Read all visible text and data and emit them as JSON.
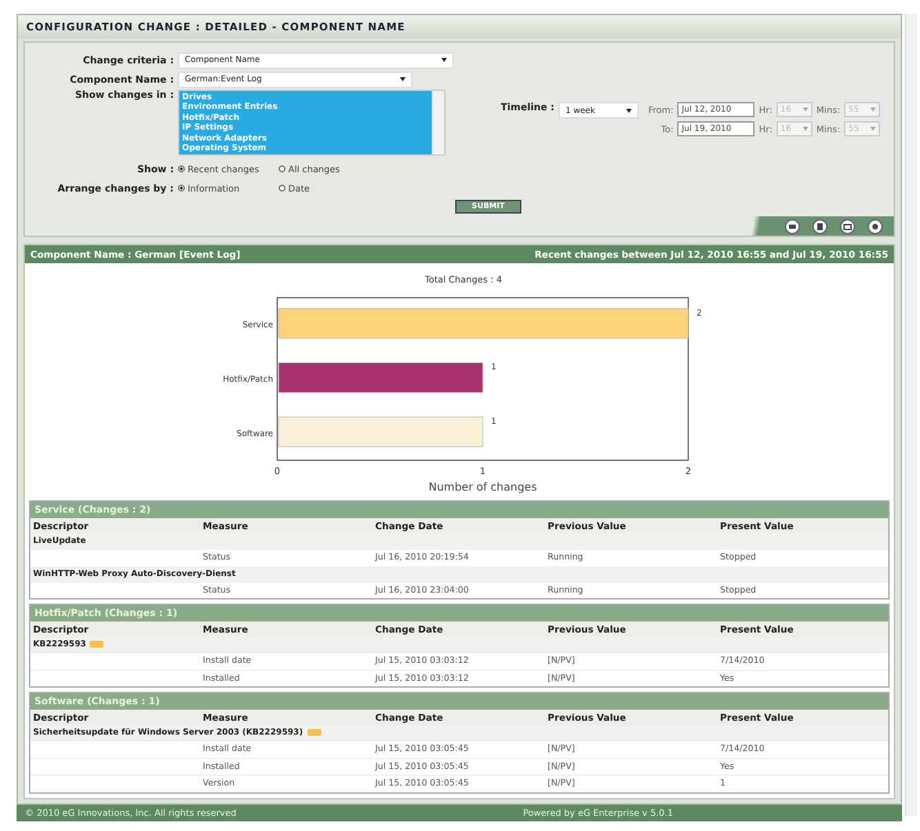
{
  "page_title": "CONFIGURATION CHANGE : DETAILED - COMPONENT NAME",
  "form": {
    "change_criteria": {
      "label": "Change criteria :",
      "value": "Component Name"
    },
    "component_name": {
      "label": "Component Name :",
      "value": "German:Event Log"
    },
    "show_changes_in": {
      "label": "Show changes in :",
      "items": [
        {
          "label": "Drives",
          "selected": true
        },
        {
          "label": "Environment Entries",
          "selected": true
        },
        {
          "label": "Hotfix/Patch",
          "selected": true
        },
        {
          "label": "IP Settings",
          "selected": true
        },
        {
          "label": "Network Adapters",
          "selected": true
        },
        {
          "label": "Operating System",
          "selected": true
        }
      ]
    },
    "show": {
      "label": "Show :",
      "options": [
        {
          "label": "Recent changes",
          "selected": true
        },
        {
          "label": "All changes",
          "selected": false
        }
      ]
    },
    "arrange_by": {
      "label": "Arrange changes by :",
      "options": [
        {
          "label": "Information",
          "selected": true
        },
        {
          "label": "Date",
          "selected": false
        }
      ]
    },
    "submit": "SUBMIT",
    "timeline": {
      "label": "Timeline :",
      "value": "1 week",
      "ranges": [
        {
          "label": "From:",
          "date": "Jul 12, 2010",
          "hr_label": "Hr:",
          "hr": "16",
          "mins_label": "Mins:",
          "mins": "55",
          "disabled": true
        },
        {
          "label": "To:",
          "date": "Jul 19, 2010",
          "hr_label": "Hr:",
          "hr": "16",
          "mins_label": "Mins:",
          "mins": "55",
          "disabled": true
        }
      ]
    }
  },
  "result_header": {
    "left": "Component Name : German [Event Log]",
    "right": "Recent changes between Jul 12, 2010 16:55 and Jul 19, 2010 16:55"
  },
  "chart_data": {
    "type": "bar",
    "orientation": "horizontal",
    "title": "Total Changes : 4",
    "xlabel": "Number of changes",
    "categories": [
      "Service",
      "Hotfix/Patch",
      "Software"
    ],
    "data_labels": true,
    "xlim": [
      0,
      2
    ],
    "xticks": [
      0,
      1,
      2
    ],
    "series": [
      {
        "color": "#fcd27a",
        "values": [
          2,
          null,
          null
        ]
      },
      {
        "color": "#a8326e",
        "values": [
          null,
          1,
          null
        ]
      },
      {
        "color": "#f8f1d8",
        "values": [
          null,
          null,
          1
        ]
      }
    ]
  },
  "groups": [
    {
      "title": "Service  (Changes : 2)",
      "columns": [
        "Descriptor",
        "Measure",
        "Change Date",
        "Previous Value",
        "Present Value"
      ],
      "items": [
        {
          "descriptor": "LiveUpdate",
          "has_note": false,
          "rows": [
            {
              "measure": "Status",
              "change_date": "Jul 16, 2010 20:19:54",
              "previous": "Running",
              "present": "Stopped"
            }
          ]
        },
        {
          "descriptor": "WinHTTP-Web Proxy Auto-Discovery-Dienst",
          "has_note": false,
          "rows": [
            {
              "measure": "Status",
              "change_date": "Jul 16, 2010 23:04:00",
              "previous": "Running",
              "present": "Stopped"
            }
          ]
        }
      ]
    },
    {
      "title": "Hotfix/Patch  (Changes : 1)",
      "columns": [
        "Descriptor",
        "Measure",
        "Change Date",
        "Previous Value",
        "Present Value"
      ],
      "items": [
        {
          "descriptor": "KB2229593",
          "has_note": true,
          "rows": [
            {
              "measure": "Install date",
              "change_date": "Jul 15, 2010 03:03:12",
              "previous": "[N/PV]",
              "present": "7/14/2010"
            },
            {
              "measure": "Installed",
              "change_date": "Jul 15, 2010 03:03:12",
              "previous": "[N/PV]",
              "present": "Yes"
            }
          ]
        }
      ]
    },
    {
      "title": "Software  (Changes : 1)",
      "columns": [
        "Descriptor",
        "Measure",
        "Change Date",
        "Previous Value",
        "Present Value"
      ],
      "items": [
        {
          "descriptor": "Sicherheitsupdate für Windows Server 2003 (KB2229593)",
          "has_note": true,
          "rows": [
            {
              "measure": "Install date",
              "change_date": "Jul 15, 2010 03:05:45",
              "previous": "[N/PV]",
              "present": "7/14/2010"
            },
            {
              "measure": "Installed",
              "change_date": "Jul 15, 2010 03:05:45",
              "previous": "[N/PV]",
              "present": "Yes"
            },
            {
              "measure": "Version",
              "change_date": "Jul 15, 2010 03:05:45",
              "previous": "[N/PV]",
              "present": "1"
            }
          ]
        }
      ]
    }
  ],
  "footer": {
    "left": "© 2010 eG Innovations, Inc. All rights reserved",
    "right": "Powered by eG Enterprise v 5.0.1"
  }
}
